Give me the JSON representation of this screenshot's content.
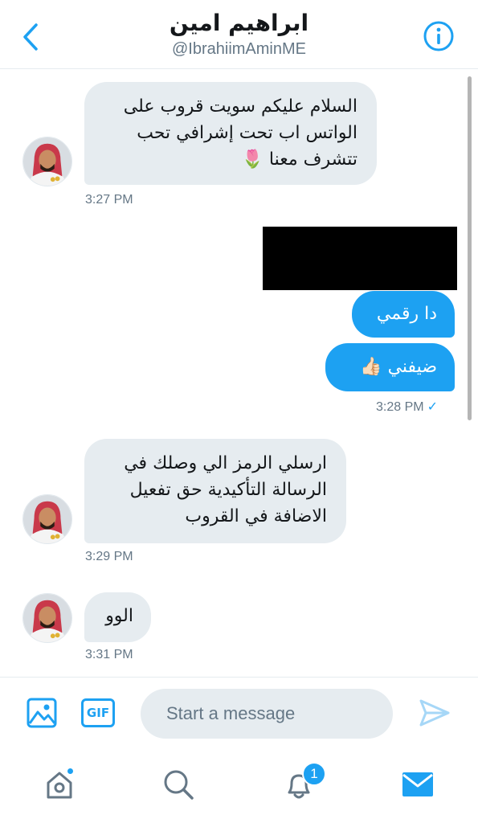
{
  "header": {
    "title": "ابراهيم امين",
    "handle": "@IbrahiimAminME"
  },
  "messages": [
    {
      "direction": "in",
      "text": "السلام عليكم سويت قروب على\nالواتس اب  تحت إشرافي  تحب\nتتشرف معنا 🌷",
      "time": "3:27 PM"
    },
    {
      "direction": "out",
      "text": "[redacted]"
    },
    {
      "direction": "out",
      "text": "دا رقمي"
    },
    {
      "direction": "out",
      "text": "ضيفني 👍🏻",
      "time": "3:28 PM",
      "status": "✓"
    },
    {
      "direction": "in",
      "text": "ارسلي الرمز الي وصلك في\nالرسالة التأكيدية حق تفعيل\nالاضافة في القروب",
      "time": "3:29 PM"
    },
    {
      "direction": "in",
      "text": "الوو",
      "time": "3:31 PM"
    }
  ],
  "composer": {
    "placeholder": "Start a message",
    "gif_label": "GIF"
  },
  "tabbar": {
    "notifications_badge": "1"
  },
  "colors": {
    "accent": "#1da1f2",
    "incoming_bubble": "#e6ecf0",
    "muted_text": "#657786"
  }
}
